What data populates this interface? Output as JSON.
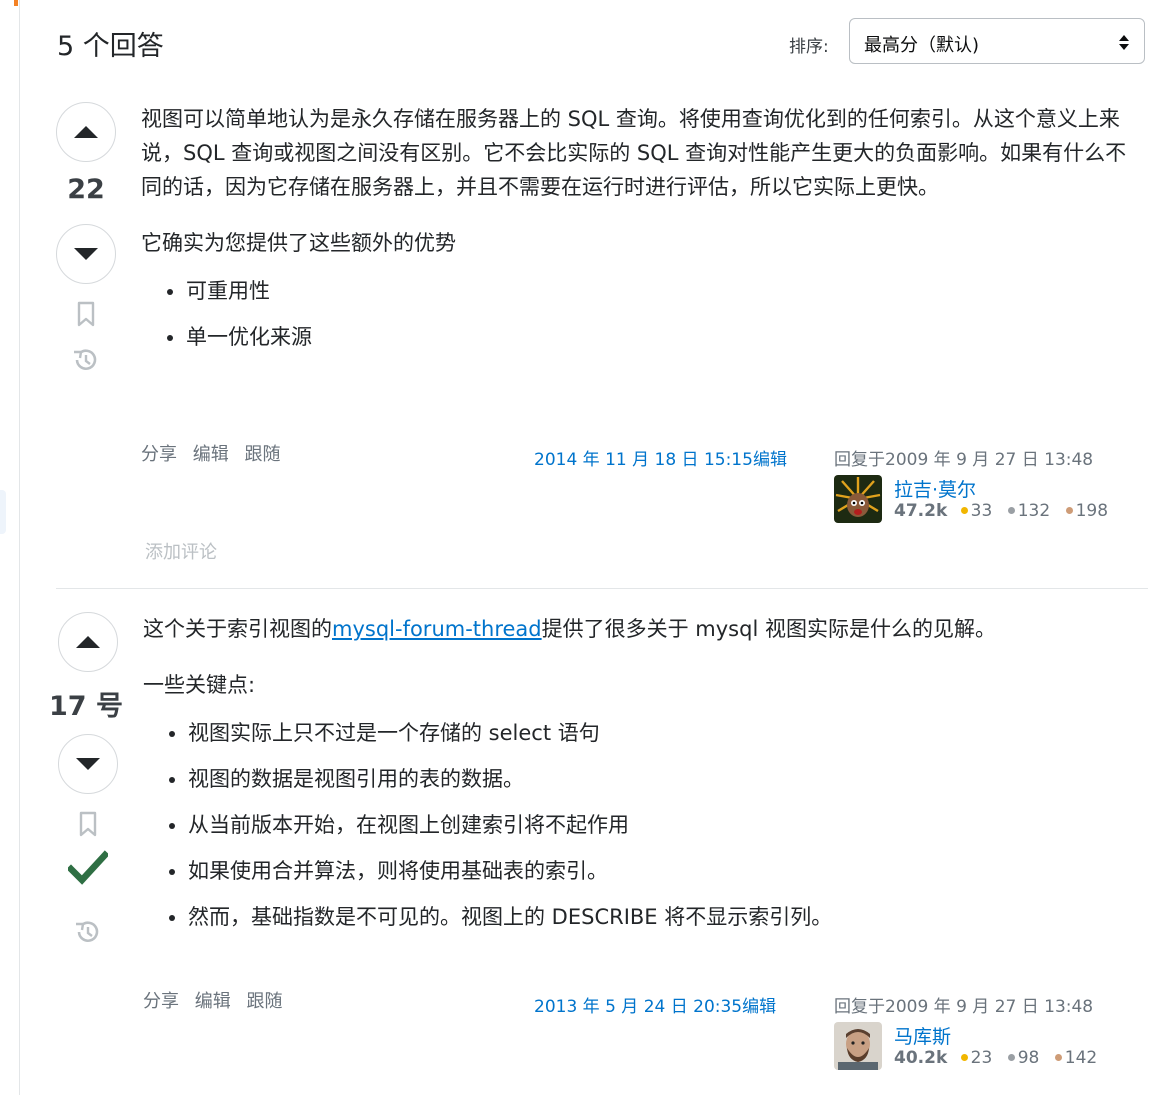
{
  "header": {
    "answers_count": "5 个回答",
    "sort_label": "排序:",
    "sort_value": "最高分（默认)"
  },
  "colors": {
    "link": "#0074cc",
    "accepted": "#2f6f44",
    "gold": "#f1b600",
    "silver": "#9a9fa4",
    "bronze": "#ce9c77"
  },
  "answers": [
    {
      "votes": "22",
      "paragraphs": [
        "视图可以简单地认为是永久存储在服务器上的 SQL 查询。将使用查询优化到的任何索引。从这个意义上来说，SQL 查询或视图之间没有区别。它不会比实际的 SQL 查询对性能产生更大的负面影响。如果有什么不同的话，因为它存储在服务器上，并且不需要在运行时进行评估，所以它实际上更快。",
        "它确实为您提供了这些额外的优势"
      ],
      "bullets": [
        "可重用性",
        "单一优化来源"
      ],
      "menu": {
        "share": "分享",
        "edit": "编辑",
        "follow": "跟随"
      },
      "edited": "2014 年 11 月 18 日 15:15编辑",
      "answered": "回复于2009 年 9 月 27 日 13:48",
      "user": {
        "name": "拉吉·莫尔",
        "rep": "47.2k",
        "gold": "33",
        "silver": "132",
        "bronze": "198"
      },
      "add_comment": "添加评论"
    },
    {
      "votes": "17 号",
      "intro_before": "这个关于索引视图的",
      "intro_link": "mysql-forum-thread",
      "intro_after": "提供了很多关于 mysql 视图实际是什么的见解。",
      "subhead": "一些关键点:",
      "bullets": [
        "视图实际上只不过是一个存储的 select 语句",
        "视图的数据是视图引用的表的数据。",
        "从当前版本开始，在视图上创建索引将不起作用",
        "如果使用合并算法，则将使用基础表的索引。",
        "然而，基础指数是不可见的。视图上的 DESCRIBE 将不显示索引列。"
      ],
      "menu": {
        "share": "分享",
        "edit": "编辑",
        "follow": "跟随"
      },
      "edited": "2013 年 5 月 24 日 20:35编辑",
      "answered": "回复于2009 年 9 月 27 日 13:48",
      "user": {
        "name": "马库斯",
        "rep": "40.2k",
        "gold": "23",
        "silver": "98",
        "bronze": "142"
      }
    }
  ]
}
